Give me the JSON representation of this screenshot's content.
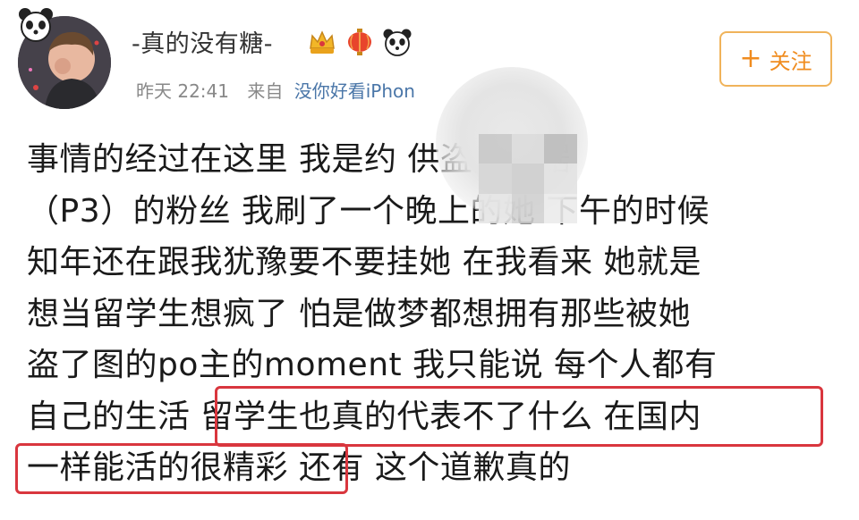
{
  "post": {
    "user_name": "-真的没有糖-",
    "time": "昨天 22:41",
    "from_label": "来自",
    "source": "没你好看iPhon",
    "follow_label": "关注",
    "body": "事情的经过在这里 我是约           供盗图证据\n（P3）的粉丝 我刷了一个晚上的她 下午的时候\n知年还在跟我犹豫要不要挂她 在我看来 她就是\n想当留学生想疯了 怕是做梦都想拥有那些被她\n盗了图的po主的moment 我只能说 每个人都有\n自己的生活 留学生也真的代表不了什么 在国内\n一样能活的很精彩 还有 这个道歉真的"
  },
  "icons": {
    "avatar_badge": "panda-icon",
    "badges": [
      "crown-icon",
      "lantern-icon",
      "panda-icon"
    ],
    "follow": "plus-icon"
  },
  "colors": {
    "follow_border": "#f0b35a",
    "follow_text": "#f08c1f",
    "highlight": "#d9363e",
    "source_link": "#4a76a8"
  }
}
